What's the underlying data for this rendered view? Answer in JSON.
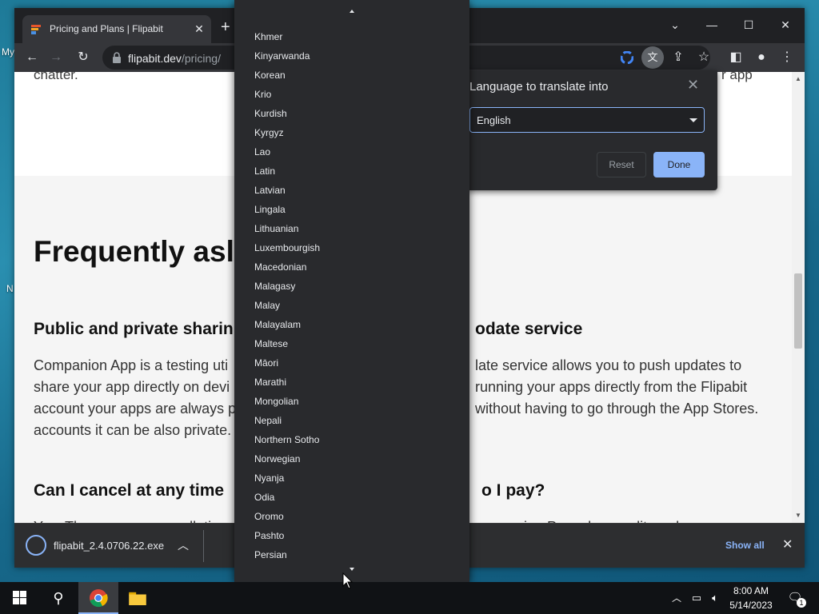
{
  "desktop": {
    "icon_labels": [
      "My",
      "N"
    ]
  },
  "browser": {
    "tab_title": "Pricing and Plans | Flipabit",
    "url_host": "flipabit.dev",
    "url_path": "/pricing/"
  },
  "page": {
    "top_text_left": "chatter.",
    "top_text_right": "r app",
    "faq_heading": "Frequently asl",
    "q1_left": "Public and private sharin",
    "q1_right": "odate service",
    "a1_left": [
      "Companion App is a testing uti",
      "share your app directly on devi",
      "account your apps are always p",
      "accounts it can be also private."
    ],
    "a1_right": [
      "late service allows you to push updates to",
      "running your apps directly from the Flipabit",
      "without having to go through the App Stores."
    ],
    "q2_left": "Can I cancel at any time",
    "q2_right": "o I pay?",
    "a2_left": "Yes. There are no cancellation",
    "a2_right": "pay using Paypal or credit card."
  },
  "download_bar": {
    "filename": "flipabit_2.4.0706.22.exe",
    "show_all": "Show all"
  },
  "translate_popup": {
    "title": "Language to translate into",
    "selected": "English",
    "reset": "Reset",
    "done": "Done"
  },
  "language_list": [
    "Khmer",
    "Kinyarwanda",
    "Korean",
    "Krio",
    "Kurdish",
    "Kyrgyz",
    "Lao",
    "Latin",
    "Latvian",
    "Lingala",
    "Lithuanian",
    "Luxembourgish",
    "Macedonian",
    "Malagasy",
    "Malay",
    "Malayalam",
    "Maltese",
    "Māori",
    "Marathi",
    "Mongolian",
    "Nepali",
    "Northern Sotho",
    "Norwegian",
    "Nyanja",
    "Odia",
    "Oromo",
    "Pashto",
    "Persian"
  ],
  "taskbar": {
    "time": "8:00 AM",
    "date": "5/14/2023",
    "notification_count": "1"
  },
  "colors": {
    "chrome_dark": "#202124",
    "accent": "#8ab4f8"
  }
}
